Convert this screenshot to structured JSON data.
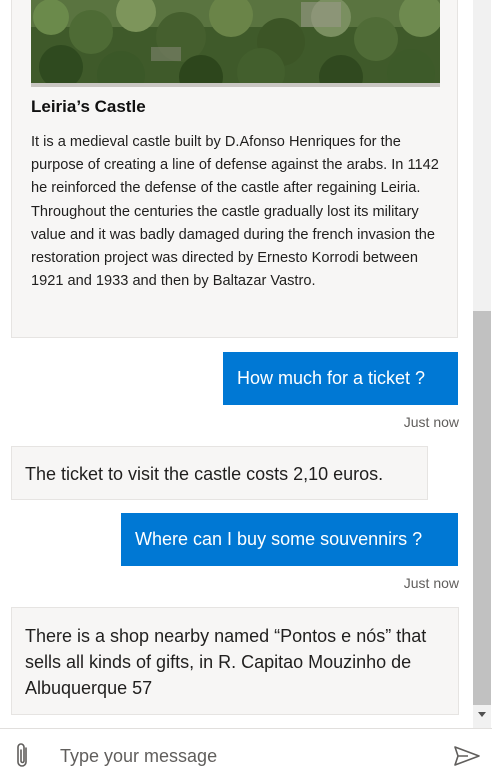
{
  "card": {
    "title": "Leiria’s Castle",
    "body": "It is a medieval castle built by D.Afonso Henriques for the purpose of creating a line of defense against the arabs. In 1142 he reinforced the defense of the castle after regaining Leiria. Throughout the centuries the castle gradually lost its military value and it was badly damaged during the french invasion the restoration project was directed by Ernesto Korrodi between 1921 and 1933 and then by Baltazar Vastro.",
    "image_icon": "castle-hillside-photo"
  },
  "messages": [
    {
      "from": "user",
      "text": "How much for a ticket ?",
      "timestamp": "Just now"
    },
    {
      "from": "bot",
      "text": "The ticket to visit the castle costs 2,10 euros."
    },
    {
      "from": "user",
      "text": "Where can I buy some souvennirs ?",
      "timestamp": "Just now"
    },
    {
      "from": "bot",
      "text": "There is a shop nearby named “Pontos e nós” that sells all kinds of gifts, in R. Capitao Mouzinho de Albuquerque 57"
    }
  ],
  "composer": {
    "placeholder": "Type your message",
    "value": "",
    "attach_icon": "paperclip-icon",
    "send_icon": "send-icon"
  },
  "colors": {
    "user_bubble": "#0078d4",
    "bot_bubble": "#f7f6f5",
    "timestamp": "#605e5c"
  }
}
